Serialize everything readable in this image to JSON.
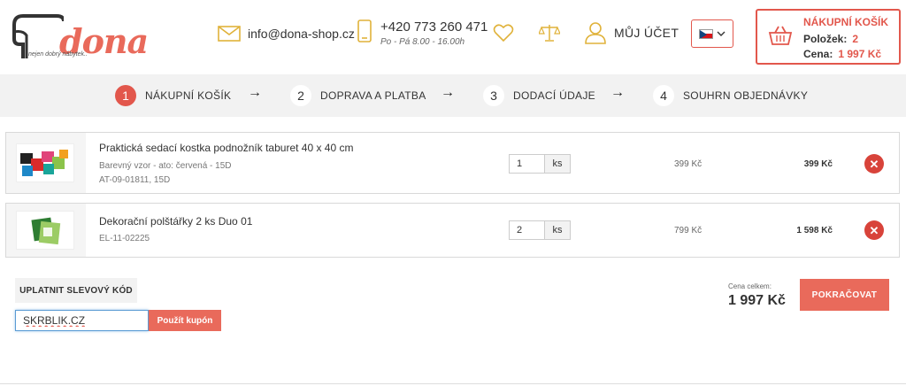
{
  "brand": {
    "name": "dona",
    "tagline": "nejen dobrý nábytek.."
  },
  "header": {
    "email": "info@dona-shop.cz",
    "phone": "+420 773 260 471",
    "hours": "Po - Pá 8.00 - 16.00h",
    "account_label": "MŮJ ÚČET",
    "accent_color": "#e2574c"
  },
  "cart": {
    "title": "NÁKUPNÍ KOŠÍK",
    "items_label": "Položek:",
    "items_value": "2",
    "price_label": "Cena:",
    "price_value": "1 997 Kč"
  },
  "steps": [
    {
      "num": "1",
      "label": "NÁKUPNÍ KOŠÍK",
      "active": true
    },
    {
      "num": "2",
      "label": "DOPRAVA A PLATBA",
      "active": false
    },
    {
      "num": "3",
      "label": "DODACÍ ÚDAJE",
      "active": false
    },
    {
      "num": "4",
      "label": "SOUHRN OBJEDNÁVKY",
      "active": false
    }
  ],
  "items": [
    {
      "name": "Praktická sedací kostka podnožník taburet 40 x 40 cm",
      "variant": "Barevný vzor - ato: červená - 15D",
      "code": "AT-09-01811, 15D",
      "qty": "1",
      "unit": "ks",
      "unit_price": "399 Kč",
      "total": "399 Kč"
    },
    {
      "name": "Dekorační polštářky 2 ks Duo 01",
      "code": "EL-11-02225",
      "qty": "2",
      "unit": "ks",
      "unit_price": "799 Kč",
      "total": "1 598 Kč"
    }
  ],
  "coupon": {
    "heading": "UPLATNIT SLEVOVÝ KÓD",
    "value": "SKRBLIK.CZ",
    "button": "Použít kupón"
  },
  "summary": {
    "label": "Cena celkem:",
    "total": "1 997 Kč",
    "continue": "POKRAČOVAT"
  }
}
